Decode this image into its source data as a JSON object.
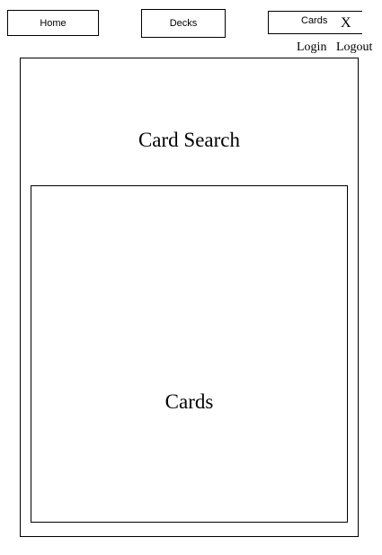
{
  "nav": {
    "home_label": "Home",
    "decks_label": "Decks",
    "cards_label": "Cards",
    "close_label": "X"
  },
  "auth": {
    "login_label": "Login",
    "logout_label": "Logout"
  },
  "main": {
    "search_label": "Card Search",
    "cards_area_label": "Cards"
  }
}
